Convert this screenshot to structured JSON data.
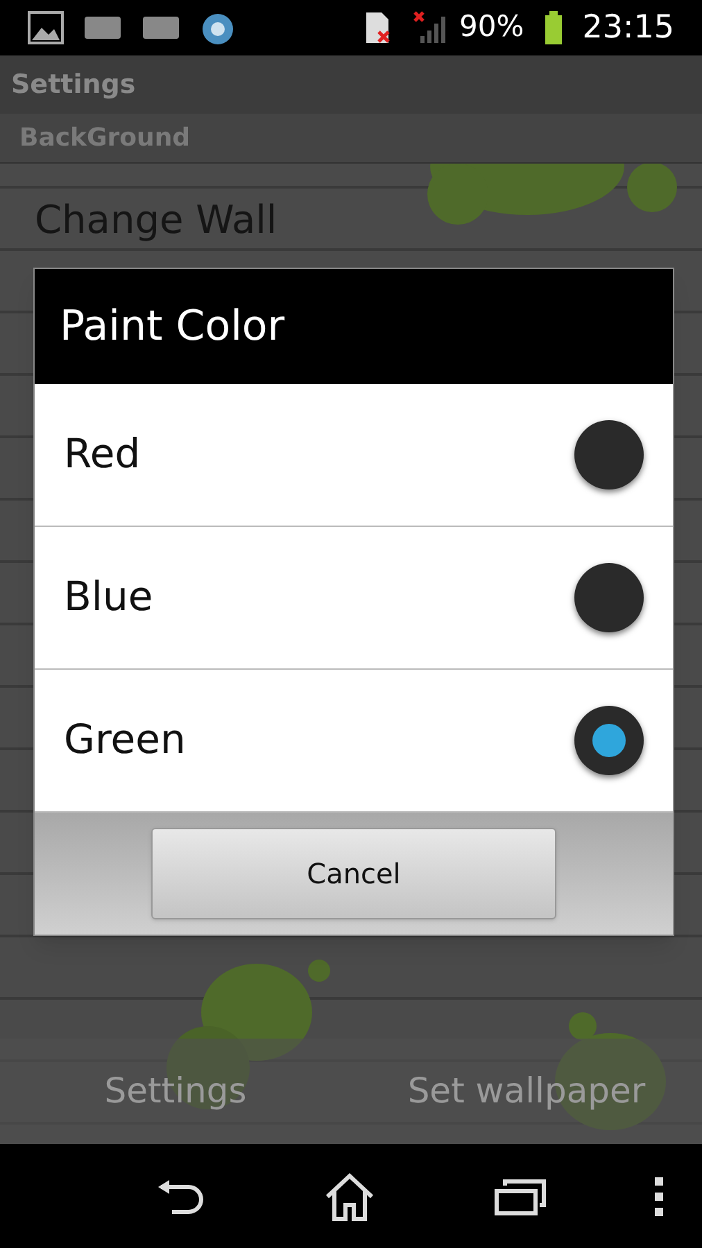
{
  "status_bar": {
    "battery": "90%",
    "time": "23:15"
  },
  "settings": {
    "title": "Settings",
    "category": "BackGround",
    "item_title": "Change Wall"
  },
  "dialog": {
    "title": "Paint Color",
    "options": [
      {
        "label": "Red",
        "selected": false
      },
      {
        "label": "Blue",
        "selected": false
      },
      {
        "label": "Green",
        "selected": true
      }
    ],
    "cancel": "Cancel"
  },
  "bottom_buttons": [
    "Settings",
    "Set wallpaper"
  ]
}
